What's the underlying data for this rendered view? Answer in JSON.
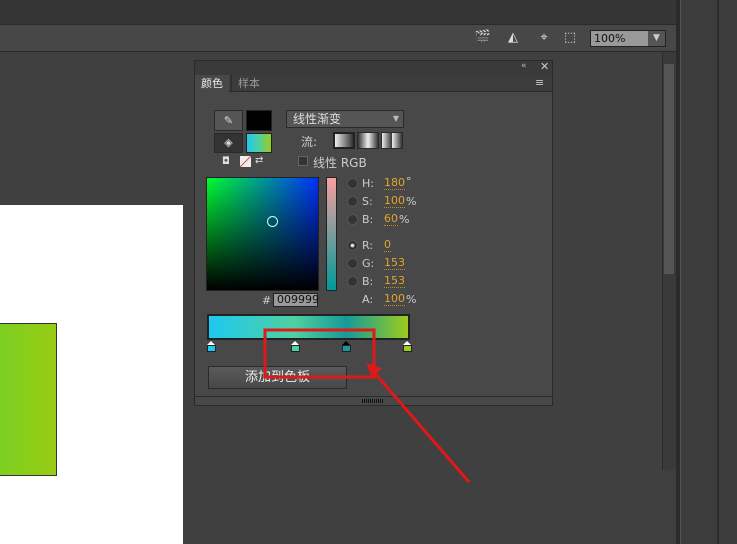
{
  "toolbar": {
    "zoom_value": "100%",
    "icons": [
      "clapperboard-icon",
      "shape-edit-icon",
      "center-stage-icon",
      "clip-icon"
    ]
  },
  "panel": {
    "tabs": [
      {
        "label": "颜色"
      },
      {
        "label": "样本"
      }
    ],
    "fill_type": "线性渐变",
    "flow_label": "流:",
    "linear_rgb_label": "线性 RGB",
    "hsb": {
      "h_label": "H:",
      "h": "180",
      "h_unit": "°",
      "s_label": "S:",
      "s": "100",
      "s_unit": "%",
      "b_label": "B:",
      "b": "60",
      "b_unit": "%"
    },
    "rgb": {
      "r_label": "R:",
      "r": "0",
      "g_label": "G:",
      "g": "153",
      "b_label": "B:",
      "b": "153",
      "a_label": "A:",
      "a": "100",
      "a_unit": "%"
    },
    "hex_label": "#",
    "hex": "009999",
    "add_swatch": "添加到色板",
    "gradient_stops": [
      "#1ec8f0",
      "#4fd0a0",
      "#169a9a",
      "#9ccc1c"
    ],
    "selected_stop": 3
  },
  "colors": {
    "stroke": "#000000",
    "accent": "#e0a52c",
    "annotation": "#e01818"
  }
}
